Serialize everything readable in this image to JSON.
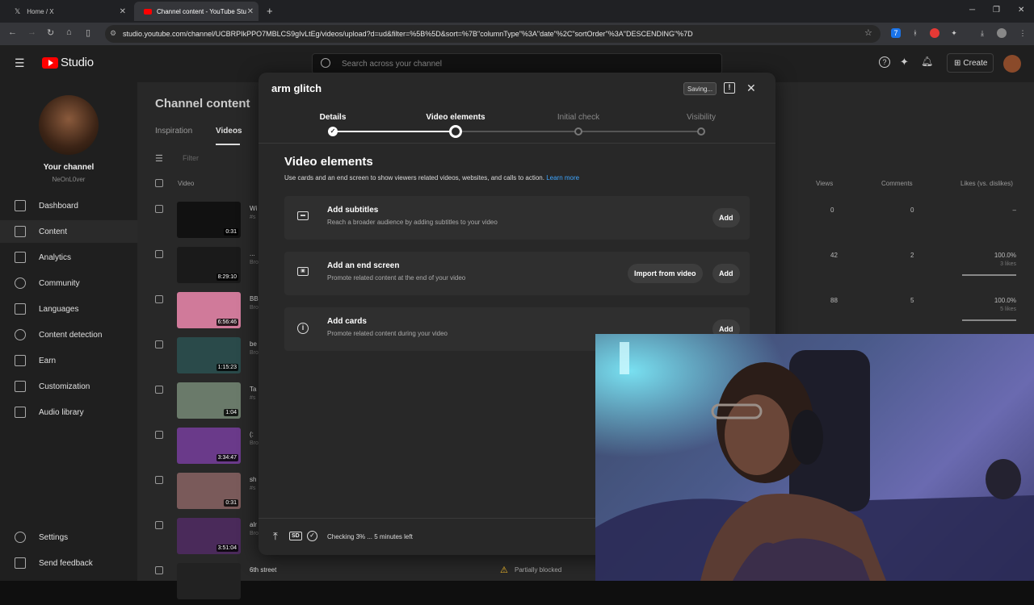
{
  "browser": {
    "tabs": [
      {
        "label": "Home / X",
        "active": false
      },
      {
        "label": "Channel content - YouTube Stu",
        "active": true
      }
    ],
    "url": "studio.youtube.com/channel/UCBRPIkPPO7MBLCS9gIvLtEg/videos/upload?d=ud&filter=%5B%5D&sort=%7B\"columnType\"%3A\"date\"%2C\"sortOrder\"%3A\"DESCENDING\"%7D"
  },
  "header": {
    "logo_text": "Studio",
    "search_placeholder": "Search across your channel",
    "create_label": "Create"
  },
  "sidebar": {
    "channel_label": "Your channel",
    "channel_handle": "NeOnL0ver",
    "items": [
      {
        "label": "Dashboard",
        "icon": "dashboard-icon"
      },
      {
        "label": "Content",
        "icon": "content-icon",
        "active": true
      },
      {
        "label": "Analytics",
        "icon": "analytics-icon"
      },
      {
        "label": "Community",
        "icon": "community-icon"
      },
      {
        "label": "Languages",
        "icon": "languages-icon"
      },
      {
        "label": "Content detection",
        "icon": "copyright-icon"
      },
      {
        "label": "Earn",
        "icon": "earn-icon"
      },
      {
        "label": "Customization",
        "icon": "customization-icon"
      },
      {
        "label": "Audio library",
        "icon": "audio-library-icon"
      }
    ],
    "bottom_items": [
      {
        "label": "Settings",
        "icon": "settings-icon"
      },
      {
        "label": "Send feedback",
        "icon": "feedback-icon"
      }
    ]
  },
  "content": {
    "title": "Channel content",
    "tabs": [
      "Inspiration",
      "Videos"
    ],
    "filter_placeholder": "Filter",
    "columns": {
      "video": "Video",
      "views": "Views",
      "comments": "Comments",
      "likes": "Likes (vs. dislikes)"
    },
    "rows": [
      {
        "duration": "0:31",
        "title": "Wi",
        "sub": "#s",
        "views": "0",
        "comments": "0",
        "likes": "–",
        "likes_sub": "",
        "thumb": "#111111"
      },
      {
        "duration": "8:29:10",
        "title": "...",
        "sub": "Bro",
        "views": "42",
        "comments": "2",
        "likes": "100.0%",
        "likes_sub": "3 likes",
        "thumb": "#1a1a1a"
      },
      {
        "duration": "6:56:46",
        "title": "BB",
        "sub": "Bro",
        "views": "88",
        "comments": "5",
        "likes": "100.0%",
        "likes_sub": "5 likes",
        "thumb": "#d07a9a"
      },
      {
        "duration": "1:15:23",
        "title": "be",
        "sub": "Bro",
        "views": "",
        "comments": "",
        "likes": "",
        "likes_sub": "",
        "thumb": "#2a4a4a"
      },
      {
        "duration": "1:04",
        "title": "Ta",
        "sub": "#s",
        "views": "",
        "comments": "",
        "likes": "",
        "likes_sub": "",
        "thumb": "#6a7a6a"
      },
      {
        "duration": "3:34:47",
        "title": "(:",
        "sub": "Bro",
        "views": "",
        "comments": "",
        "likes": "",
        "likes_sub": "",
        "thumb": "#6a3a8a"
      },
      {
        "duration": "0:31",
        "title": "sh",
        "sub": "#s",
        "views": "",
        "comments": "",
        "likes": "",
        "likes_sub": "",
        "thumb": "#7a5a5a"
      },
      {
        "duration": "3:51:04",
        "title": "alr",
        "sub": "Bro",
        "views": "",
        "comments": "",
        "likes": "",
        "likes_sub": "",
        "thumb": "#4a2a5a"
      },
      {
        "duration": "",
        "title": "6th street",
        "sub": "",
        "views": "",
        "comments": "",
        "likes": "",
        "likes_sub": "",
        "thumb": "#222222"
      }
    ],
    "partially_blocked": "Partially blocked"
  },
  "modal": {
    "title": "arm glitch",
    "saving_label": "Saving...",
    "steps": [
      {
        "label": "Details",
        "state": "done"
      },
      {
        "label": "Video elements",
        "state": "current"
      },
      {
        "label": "Initial check",
        "state": "todo"
      },
      {
        "label": "Visibility",
        "state": "todo"
      }
    ],
    "section_title": "Video elements",
    "section_desc": "Use cards and an end screen to show viewers related videos, websites, and calls to action.",
    "learn_more": "Learn more",
    "cards": [
      {
        "title": "Add subtitles",
        "desc": "Reach a broader audience by adding subtitles to your video",
        "icon": "subtitles-icon",
        "add_label": "Add"
      },
      {
        "title": "Add an end screen",
        "desc": "Promote related content at the end of your video",
        "icon": "end-screen-icon",
        "import_label": "Import from video",
        "add_label": "Add"
      },
      {
        "title": "Add cards",
        "desc": "Promote related content during your video",
        "icon": "info-icon",
        "add_label": "Add"
      }
    ],
    "footer_status": "Checking 3% ... 5 minutes left",
    "sd_badge": "SD"
  }
}
